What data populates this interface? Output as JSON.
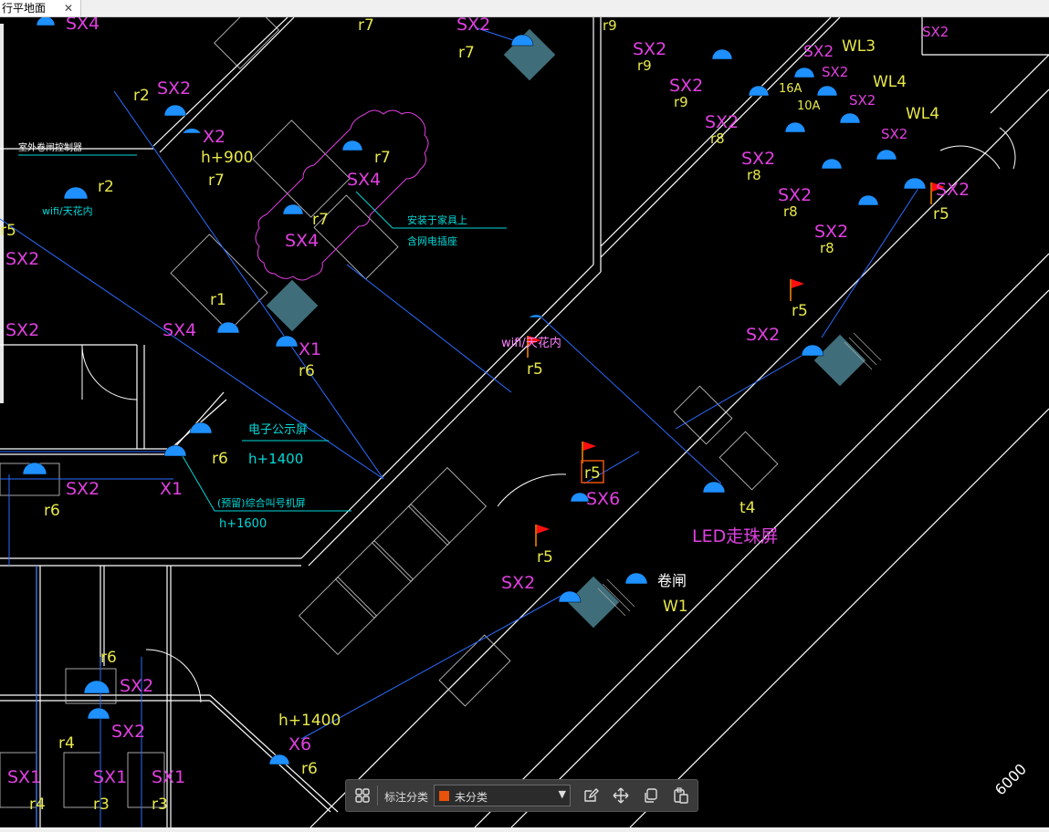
{
  "tab": {
    "title": "行平地面",
    "close_glyph": "✕"
  },
  "toolbar": {
    "group_icon": "grid-icon",
    "label": "标注分类",
    "category_color": "#e8520a",
    "category_value": "未分类",
    "edit_icon": "edit-icon",
    "move_icon": "move-icon",
    "copy_icon": "copy-icon",
    "paste_icon": "paste-icon"
  },
  "colors": {
    "wall": "#ffffff",
    "wire": "#2a6cff",
    "magenta": "#e040e0",
    "yellow": "#e8e84a",
    "cyan": "#00d8d8",
    "device": "#1e90ff",
    "flag": "#ff1010",
    "pink": "#ff80ff"
  },
  "labels": {
    "magenta": [
      "SX4",
      "SX2",
      "X2",
      "SX2",
      "SX4",
      "SX4",
      "SX2",
      "SX2",
      "SX4",
      "X1",
      "SX2",
      "X1",
      "SX6",
      "LED走珠屏",
      "SX2",
      "SX2",
      "SX2",
      "SX1",
      "SX1",
      "SX1",
      "X6",
      "SX2",
      "SX2",
      "SX2",
      "SX2",
      "SX2",
      "SX2",
      "SX2",
      "SX2",
      "SX2",
      "SX2",
      "SX2",
      "SX2",
      "SX2"
    ],
    "yellow": [
      "r7",
      "r7",
      "r2",
      "h+900",
      "r7",
      "r2",
      "r7",
      "r7",
      "r1",
      "r6",
      "r5",
      "r5",
      "r6",
      "r6",
      "r5",
      "r5",
      "t4",
      "W1",
      "r6",
      "r4",
      "r4",
      "r3",
      "r3",
      "h+1400",
      "r6",
      "r9",
      "r9",
      "r9",
      "r8",
      "r8",
      "r8",
      "r8",
      "r5",
      "WL3",
      "WL4",
      "WL4",
      "16A",
      "10A",
      "r5"
    ],
    "white": [
      "室外卷闸控制器",
      "卷闸",
      "6000"
    ],
    "cyan": [
      "wifi/天花内",
      "安装于家具上",
      "含网电插座",
      "电子公示屏",
      "h+1400",
      "(预留)综合叫号机屏",
      "h+1600",
      "wifi/天花内"
    ]
  }
}
